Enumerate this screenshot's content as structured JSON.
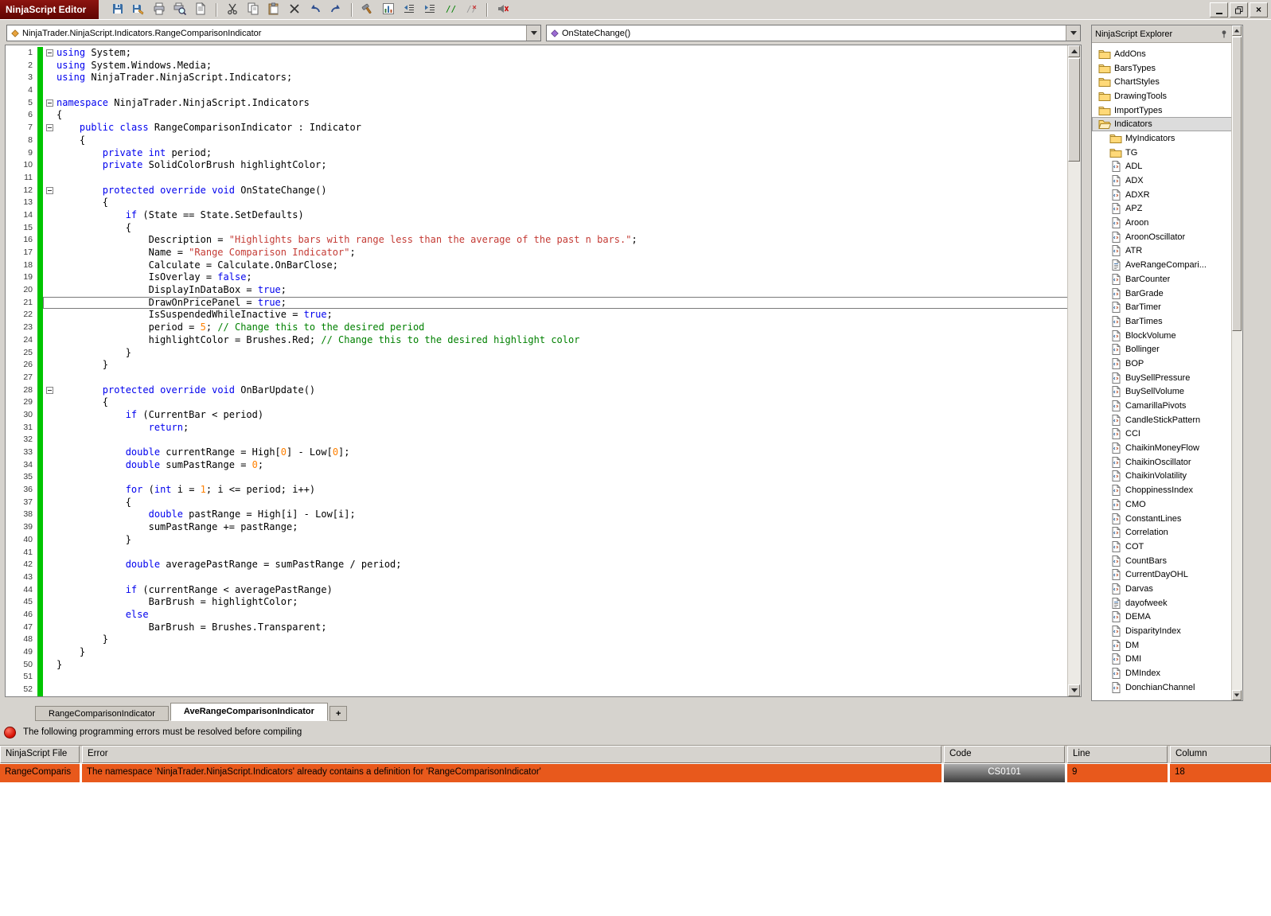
{
  "window": {
    "title": "NinjaScript Editor"
  },
  "toolbar": {
    "buttons": [
      {
        "name": "save-button",
        "icon": "floppy"
      },
      {
        "name": "save-as-button",
        "icon": "floppy2"
      },
      {
        "name": "print-button",
        "icon": "printer"
      },
      {
        "name": "print-preview-button",
        "icon": "printprev"
      },
      {
        "name": "page-setup-button",
        "icon": "page"
      },
      {
        "sep": true
      },
      {
        "name": "cut-button",
        "icon": "scissors"
      },
      {
        "name": "copy-button",
        "icon": "copy"
      },
      {
        "name": "paste-button",
        "icon": "paste"
      },
      {
        "name": "delete-button",
        "icon": "xmark"
      },
      {
        "name": "undo-button",
        "icon": "undo"
      },
      {
        "name": "redo-button",
        "icon": "redo"
      },
      {
        "sep": true
      },
      {
        "name": "compile-button",
        "icon": "hammer"
      },
      {
        "name": "analyzer-button",
        "icon": "chart"
      },
      {
        "name": "outdent-button",
        "icon": "outdent"
      },
      {
        "name": "indent-button",
        "icon": "indent"
      },
      {
        "name": "comment-button",
        "icon": "comment"
      },
      {
        "name": "uncomment-button",
        "icon": "comment2"
      },
      {
        "sep": true
      },
      {
        "name": "toggle-alerts-button",
        "icon": "mute"
      }
    ]
  },
  "combos": {
    "class_selector": "NinjaTrader.NinjaScript.Indicators.RangeComparisonIndicator",
    "member_selector": "OnStateChange()"
  },
  "editor": {
    "lines": [
      {
        "n": 1,
        "f": 1,
        "seg": [
          [
            "k",
            "using"
          ],
          [
            "p",
            " System;"
          ]
        ]
      },
      {
        "n": 2,
        "seg": [
          [
            "k",
            "using"
          ],
          [
            "p",
            " System.Windows.Media;"
          ]
        ]
      },
      {
        "n": 3,
        "seg": [
          [
            "k",
            "using"
          ],
          [
            "p",
            " NinjaTrader.NinjaScript.Indicators;"
          ]
        ]
      },
      {
        "n": 4,
        "seg": []
      },
      {
        "n": 5,
        "f": 1,
        "seg": [
          [
            "k",
            "namespace"
          ],
          [
            "p",
            " NinjaTrader.NinjaScript.Indicators"
          ]
        ]
      },
      {
        "n": 6,
        "seg": [
          [
            "p",
            "{"
          ]
        ]
      },
      {
        "n": 7,
        "f": 1,
        "seg": [
          [
            "p",
            "    "
          ],
          [
            "k",
            "public"
          ],
          [
            "p",
            " "
          ],
          [
            "k",
            "class"
          ],
          [
            "p",
            " RangeComparisonIndicator : Indicator"
          ]
        ]
      },
      {
        "n": 8,
        "seg": [
          [
            "p",
            "    {"
          ]
        ]
      },
      {
        "n": 9,
        "seg": [
          [
            "p",
            "        "
          ],
          [
            "k",
            "private"
          ],
          [
            "p",
            " "
          ],
          [
            "k",
            "int"
          ],
          [
            "p",
            " period;"
          ]
        ]
      },
      {
        "n": 10,
        "seg": [
          [
            "p",
            "        "
          ],
          [
            "k",
            "private"
          ],
          [
            "p",
            " SolidColorBrush highlightColor;"
          ]
        ]
      },
      {
        "n": 11,
        "seg": []
      },
      {
        "n": 12,
        "f": 1,
        "seg": [
          [
            "p",
            "        "
          ],
          [
            "k",
            "protected"
          ],
          [
            "p",
            " "
          ],
          [
            "k",
            "override"
          ],
          [
            "p",
            " "
          ],
          [
            "k",
            "void"
          ],
          [
            "p",
            " OnStateChange()"
          ]
        ]
      },
      {
        "n": 13,
        "seg": [
          [
            "p",
            "        {"
          ]
        ]
      },
      {
        "n": 14,
        "seg": [
          [
            "p",
            "            "
          ],
          [
            "k",
            "if"
          ],
          [
            "p",
            " (State == State.SetDefaults)"
          ]
        ]
      },
      {
        "n": 15,
        "seg": [
          [
            "p",
            "            {"
          ]
        ]
      },
      {
        "n": 16,
        "seg": [
          [
            "p",
            "                Description = "
          ],
          [
            "s",
            "\"Highlights bars with range less than the average of the past n bars.\""
          ],
          [
            "p",
            ";"
          ]
        ]
      },
      {
        "n": 17,
        "seg": [
          [
            "p",
            "                Name = "
          ],
          [
            "s",
            "\"Range Comparison Indicator\""
          ],
          [
            "p",
            ";"
          ]
        ]
      },
      {
        "n": 18,
        "seg": [
          [
            "p",
            "                Calculate = Calculate.OnBarClose;"
          ]
        ]
      },
      {
        "n": 19,
        "seg": [
          [
            "p",
            "                IsOverlay = "
          ],
          [
            "k",
            "false"
          ],
          [
            "p",
            ";"
          ]
        ]
      },
      {
        "n": 20,
        "seg": [
          [
            "p",
            "                DisplayInDataBox = "
          ],
          [
            "k",
            "true"
          ],
          [
            "p",
            ";"
          ]
        ]
      },
      {
        "n": 21,
        "cur": 1,
        "seg": [
          [
            "p",
            "                DrawOnPricePanel = "
          ],
          [
            "k",
            "true"
          ],
          [
            "p",
            ";"
          ]
        ]
      },
      {
        "n": 22,
        "seg": [
          [
            "p",
            "                IsSuspendedWhileInactive = "
          ],
          [
            "k",
            "true"
          ],
          [
            "p",
            ";"
          ]
        ]
      },
      {
        "n": 23,
        "seg": [
          [
            "p",
            "                period = "
          ],
          [
            "d",
            "5"
          ],
          [
            "p",
            "; "
          ],
          [
            "c",
            "// Change this to the desired period"
          ]
        ]
      },
      {
        "n": 24,
        "seg": [
          [
            "p",
            "                highlightColor = Brushes.Red; "
          ],
          [
            "c",
            "// Change this to the desired highlight color"
          ]
        ]
      },
      {
        "n": 25,
        "seg": [
          [
            "p",
            "            }"
          ]
        ]
      },
      {
        "n": 26,
        "seg": [
          [
            "p",
            "        }"
          ]
        ]
      },
      {
        "n": 27,
        "seg": []
      },
      {
        "n": 28,
        "f": 1,
        "seg": [
          [
            "p",
            "        "
          ],
          [
            "k",
            "protected"
          ],
          [
            "p",
            " "
          ],
          [
            "k",
            "override"
          ],
          [
            "p",
            " "
          ],
          [
            "k",
            "void"
          ],
          [
            "p",
            " OnBarUpdate()"
          ]
        ]
      },
      {
        "n": 29,
        "seg": [
          [
            "p",
            "        {"
          ]
        ]
      },
      {
        "n": 30,
        "seg": [
          [
            "p",
            "            "
          ],
          [
            "k",
            "if"
          ],
          [
            "p",
            " (CurrentBar < period)"
          ]
        ]
      },
      {
        "n": 31,
        "seg": [
          [
            "p",
            "                "
          ],
          [
            "k",
            "return"
          ],
          [
            "p",
            ";"
          ]
        ]
      },
      {
        "n": 32,
        "seg": []
      },
      {
        "n": 33,
        "seg": [
          [
            "p",
            "            "
          ],
          [
            "k",
            "double"
          ],
          [
            "p",
            " currentRange = High["
          ],
          [
            "d",
            "0"
          ],
          [
            "p",
            "] - Low["
          ],
          [
            "d",
            "0"
          ],
          [
            "p",
            "];"
          ]
        ]
      },
      {
        "n": 34,
        "seg": [
          [
            "p",
            "            "
          ],
          [
            "k",
            "double"
          ],
          [
            "p",
            " sumPastRange = "
          ],
          [
            "d",
            "0"
          ],
          [
            "p",
            ";"
          ]
        ]
      },
      {
        "n": 35,
        "seg": []
      },
      {
        "n": 36,
        "seg": [
          [
            "p",
            "            "
          ],
          [
            "k",
            "for"
          ],
          [
            "p",
            " ("
          ],
          [
            "k",
            "int"
          ],
          [
            "p",
            " i = "
          ],
          [
            "d",
            "1"
          ],
          [
            "p",
            "; i <= period; i++)"
          ]
        ]
      },
      {
        "n": 37,
        "seg": [
          [
            "p",
            "            {"
          ]
        ]
      },
      {
        "n": 38,
        "seg": [
          [
            "p",
            "                "
          ],
          [
            "k",
            "double"
          ],
          [
            "p",
            " pastRange = High[i] - Low[i];"
          ]
        ]
      },
      {
        "n": 39,
        "seg": [
          [
            "p",
            "                sumPastRange += pastRange;"
          ]
        ]
      },
      {
        "n": 40,
        "seg": [
          [
            "p",
            "            }"
          ]
        ]
      },
      {
        "n": 41,
        "seg": []
      },
      {
        "n": 42,
        "seg": [
          [
            "p",
            "            "
          ],
          [
            "k",
            "double"
          ],
          [
            "p",
            " averagePastRange = sumPastRange / period;"
          ]
        ]
      },
      {
        "n": 43,
        "seg": []
      },
      {
        "n": 44,
        "seg": [
          [
            "p",
            "            "
          ],
          [
            "k",
            "if"
          ],
          [
            "p",
            " (currentRange < averagePastRange)"
          ]
        ]
      },
      {
        "n": 45,
        "seg": [
          [
            "p",
            "                BarBrush = highlightColor;"
          ]
        ]
      },
      {
        "n": 46,
        "seg": [
          [
            "p",
            "            "
          ],
          [
            "k",
            "else"
          ]
        ]
      },
      {
        "n": 47,
        "seg": [
          [
            "p",
            "                BarBrush = Brushes.Transparent;"
          ]
        ]
      },
      {
        "n": 48,
        "seg": [
          [
            "p",
            "        }"
          ]
        ]
      },
      {
        "n": 49,
        "seg": [
          [
            "p",
            "    }"
          ]
        ]
      },
      {
        "n": 50,
        "seg": [
          [
            "p",
            "}"
          ]
        ]
      },
      {
        "n": 51,
        "seg": []
      },
      {
        "n": 52,
        "seg": []
      }
    ]
  },
  "explorer": {
    "title": "NinjaScript Explorer",
    "items": [
      {
        "label": "AddOns",
        "icon": "folder",
        "indent": 0
      },
      {
        "label": "BarsTypes",
        "icon": "folder",
        "indent": 0
      },
      {
        "label": "ChartStyles",
        "icon": "folder",
        "indent": 0
      },
      {
        "label": "DrawingTools",
        "icon": "folder",
        "indent": 0
      },
      {
        "label": "ImportTypes",
        "icon": "folder",
        "indent": 0
      },
      {
        "label": "Indicators",
        "icon": "folderOpen",
        "indent": 0,
        "selected": true
      },
      {
        "label": "MyIndicators",
        "icon": "folder",
        "indent": 1
      },
      {
        "label": "TG",
        "icon": "folder",
        "indent": 1
      },
      {
        "label": "ADL",
        "icon": "file",
        "indent": 1
      },
      {
        "label": "ADX",
        "icon": "file",
        "indent": 1
      },
      {
        "label": "ADXR",
        "icon": "file",
        "indent": 1
      },
      {
        "label": "APZ",
        "icon": "file",
        "indent": 1
      },
      {
        "label": "Aroon",
        "icon": "file",
        "indent": 1
      },
      {
        "label": "AroonOscillator",
        "icon": "file",
        "indent": 1
      },
      {
        "label": "ATR",
        "icon": "file",
        "indent": 1
      },
      {
        "label": "AveRangeCompari...",
        "icon": "file2",
        "indent": 1
      },
      {
        "label": "BarCounter",
        "icon": "file",
        "indent": 1
      },
      {
        "label": "BarGrade",
        "icon": "file",
        "indent": 1
      },
      {
        "label": "BarTimer",
        "icon": "file",
        "indent": 1
      },
      {
        "label": "BarTimes",
        "icon": "file",
        "indent": 1
      },
      {
        "label": "BlockVolume",
        "icon": "file",
        "indent": 1
      },
      {
        "label": "Bollinger",
        "icon": "file",
        "indent": 1
      },
      {
        "label": "BOP",
        "icon": "file",
        "indent": 1
      },
      {
        "label": "BuySellPressure",
        "icon": "file",
        "indent": 1
      },
      {
        "label": "BuySellVolume",
        "icon": "file",
        "indent": 1
      },
      {
        "label": "CamarillaPivots",
        "icon": "file",
        "indent": 1
      },
      {
        "label": "CandleStickPattern",
        "icon": "file",
        "indent": 1
      },
      {
        "label": "CCI",
        "icon": "file",
        "indent": 1
      },
      {
        "label": "ChaikinMoneyFlow",
        "icon": "file",
        "indent": 1
      },
      {
        "label": "ChaikinOscillator",
        "icon": "file",
        "indent": 1
      },
      {
        "label": "ChaikinVolatility",
        "icon": "file",
        "indent": 1
      },
      {
        "label": "ChoppinessIndex",
        "icon": "file",
        "indent": 1
      },
      {
        "label": "CMO",
        "icon": "file",
        "indent": 1
      },
      {
        "label": "ConstantLines",
        "icon": "file",
        "indent": 1
      },
      {
        "label": "Correlation",
        "icon": "file",
        "indent": 1
      },
      {
        "label": "COT",
        "icon": "file",
        "indent": 1
      },
      {
        "label": "CountBars",
        "icon": "file",
        "indent": 1
      },
      {
        "label": "CurrentDayOHL",
        "icon": "file",
        "indent": 1
      },
      {
        "label": "Darvas",
        "icon": "file",
        "indent": 1
      },
      {
        "label": "dayofweek",
        "icon": "file2",
        "indent": 1
      },
      {
        "label": "DEMA",
        "icon": "file",
        "indent": 1
      },
      {
        "label": "DisparityIndex",
        "icon": "file",
        "indent": 1
      },
      {
        "label": "DM",
        "icon": "file",
        "indent": 1
      },
      {
        "label": "DMI",
        "icon": "file",
        "indent": 1
      },
      {
        "label": "DMIndex",
        "icon": "file",
        "indent": 1
      },
      {
        "label": "DonchianChannel",
        "icon": "file",
        "indent": 1
      }
    ]
  },
  "tabs": [
    {
      "label": "RangeComparisonIndicator",
      "active": false
    },
    {
      "label": "AveRangeComparisonIndicator",
      "active": true
    },
    {
      "label": "+",
      "plus": true
    }
  ],
  "error_panel": {
    "message": "The following programming errors must be resolved before compiling",
    "columns": [
      "NinjaScript File",
      "Error",
      "Code",
      "Line",
      "Column"
    ],
    "rows": [
      {
        "file": "RangeComparis",
        "error": "The namespace 'NinjaTrader.NinjaScript.Indicators' already contains a definition for 'RangeComparisonIndicator'",
        "code": "CS0101",
        "line": "9",
        "column": "18"
      }
    ]
  },
  "colors": {
    "keyword": "#0000EE",
    "string": "#C43B35",
    "comment": "#008000",
    "number": "#FF8000",
    "error_row": "#E8591C",
    "title_bar": "#8C1410",
    "change_bar": "#00C400"
  }
}
